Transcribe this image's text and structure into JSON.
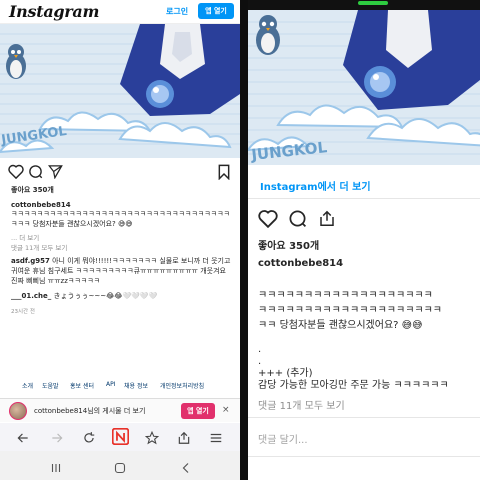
{
  "left": {
    "header": {
      "logo": "Instagram",
      "login": "로그인",
      "open_app": "앱 열기"
    },
    "image": {
      "scene": "penguin-cloud-jacket-photo",
      "jacket_text_fragment": "JUNGKOL"
    },
    "actions": {
      "like_icon": "heart-icon",
      "comment_icon": "comment-icon",
      "share_icon": "send-icon",
      "save_icon": "bookmark-icon"
    },
    "likes": "좋아요 350개",
    "caption": {
      "username": "cottonbebe814",
      "text": "ㅋㅋㅋㅋㅋㅋㅋㅋㅋㅋㅋㅋㅋㅋㅋㅋㅋㅋㅋㅋㅋㅋㅋㅋㅋㅋㅋㅋㅋㅋㅋㅋㅋㅋㅋㅋㅋ 당첨자분들 괜찮으시겠어요? 😅😅",
      "more": "... 더 보기"
    },
    "view_all": "댓글 11개 모두 보기",
    "comments": [
      {
        "username": "asdf.g957",
        "text": "아니 이게 뭐야!!!!!!ㅋㅋㅋㅋㅋㅋㅋ 실물로 보니까 더 웃기고 귀여운 휴님 침구세트 ㅋㅋㅋㅋㅋㅋㅋㅋㅋ큐ㅠㅠㅠㅠㅠㅠㅠㅠㅠ 개웃겨요 진짜 삐삐님 ㅠㅠzzㅋㅋㅋㅋㅋ"
      },
      {
        "username": "___01.che_",
        "text": "きょうぅぅ~~~😂😂🤍🤍🤍🤍"
      }
    ],
    "timestamp": "23시간 전",
    "footer_links": [
      "소개",
      "도움말",
      "홍보 센터",
      "API",
      "채용 정보",
      "개인정보처리방침"
    ],
    "banner": {
      "text": "cottonbebe814님의 게시물 더 보기",
      "button": "앱 열기",
      "close": "×"
    },
    "browser_toolbar": [
      "back-arrow-icon",
      "forward-arrow-icon",
      "reload-icon",
      "naver-n-icon",
      "star-icon",
      "share-icon",
      "menu-icon"
    ],
    "nav_bar": [
      "recents-icon",
      "home-icon",
      "back-icon"
    ]
  },
  "right": {
    "ig_more": "Instagram에서 더 보기",
    "likes": "좋아요 350개",
    "username": "cottonbebe814",
    "caption_lines": [
      "ㅋㅋㅋㅋㅋㅋㅋㅋㅋㅋㅋㅋㅋㅋㅋㅋㅋㅋㅋ",
      "ㅋㅋㅋㅋㅋㅋㅋㅋㅋㅋㅋㅋㅋㅋㅋㅋㅋㅋㅋㅋ",
      "ㅋㅋ 당첨자분들 괜찮으시겠어요? 😅😅"
    ],
    "extra_lines": [
      ".",
      ".",
      "+++ (추가)",
      "감당 가능한 모아깅만 주문 가능 ㅋㅋㅋㅋㅋㅋ"
    ],
    "view_all": "댓글 11개 모두 보기",
    "add_comment": "댓글 달기..."
  },
  "colors": {
    "link_blue": "#0095f6",
    "banner_pink": "#e1306c",
    "muted_gray": "#8e8e8e",
    "sky_blue": "#9cc7ea"
  }
}
